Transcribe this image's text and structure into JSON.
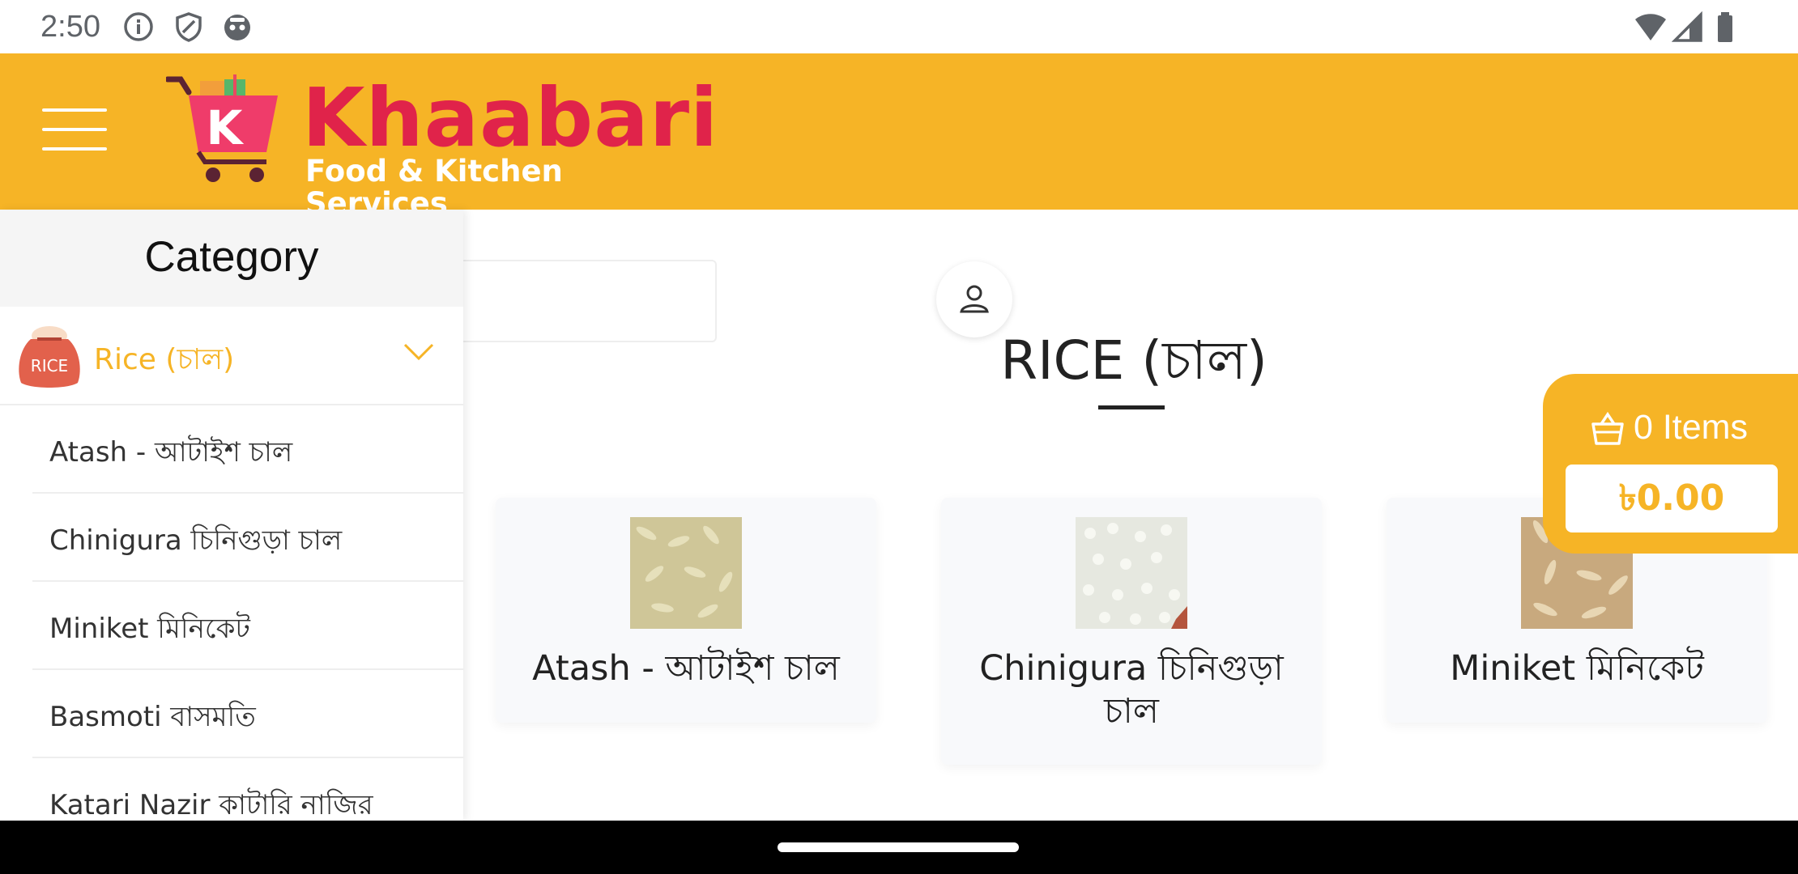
{
  "status_bar": {
    "time": "2:50",
    "left_icons": [
      "info-icon",
      "shield-icon",
      "robot-face-icon"
    ],
    "right_icons": [
      "wifi-icon",
      "cell-signal-icon",
      "battery-icon"
    ]
  },
  "header": {
    "menu_icon": "hamburger-menu-icon",
    "logo": {
      "title": "Khaabari",
      "subtitle": "Food & Kitchen Services",
      "badge_letter": "K"
    },
    "colors": {
      "background": "#f6b426",
      "brand": "#e0234a"
    }
  },
  "drawer": {
    "title": "Category",
    "category": {
      "label": "Rice (চাল)",
      "icon_text": "RICE",
      "expanded": true
    },
    "items": [
      {
        "label": "Atash - আটাইশ চাল"
      },
      {
        "label": "Chinigura চিনিগুড়া চাল"
      },
      {
        "label": "Miniket মিনিকেট"
      },
      {
        "label": "Basmoti বাসমতি"
      },
      {
        "label": "Katari Nazir কাটারি নাজির"
      }
    ]
  },
  "main": {
    "search_placeholder": "",
    "user_icon": "user-icon",
    "title": "RICE (চাল)",
    "products": [
      {
        "name": "Atash - আটাইশ চাল"
      },
      {
        "name": "Chinigura চিনিগুড়া চাল"
      },
      {
        "name": "Miniket মিনিকেট"
      }
    ]
  },
  "cart": {
    "count_text": "0 Items",
    "total": "৳0.00",
    "icon": "basket-icon"
  }
}
